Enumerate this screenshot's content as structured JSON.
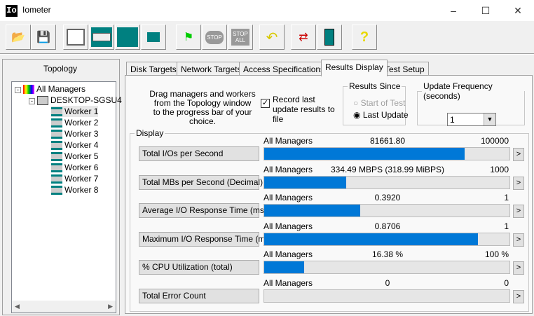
{
  "window": {
    "title": "Iometer",
    "icon_text": "Io"
  },
  "toolbar": {
    "buttons": [
      "open-icon",
      "save-icon",
      "start-manager-icon",
      "new-worker-icon",
      "new-network-worker-icon",
      "duplicate-worker-icon",
      "start-icon",
      "stop-icon",
      "stop-all-icon",
      "reset-icon",
      "disconnect-icon",
      "exit-icon",
      "help-icon"
    ],
    "stop_label": "STOP",
    "stop_all_label": "ALL",
    "help_label": "?"
  },
  "topology": {
    "title": "Topology",
    "root": "All Managers",
    "manager": "DESKTOP-SGSU4",
    "workers": [
      "Worker 1",
      "Worker 2",
      "Worker 3",
      "Worker 4",
      "Worker 5",
      "Worker 6",
      "Worker 7",
      "Worker 8"
    ]
  },
  "tabs": [
    "Disk Targets",
    "Network Targets",
    "Access Specifications",
    "Results Display",
    "Test Setup"
  ],
  "active_tab": "Results Display",
  "results": {
    "instructions": [
      "Drag managers and workers",
      "from the Topology window",
      "to the progress bar of your choice."
    ],
    "record_label": "Record last update results to file",
    "record_checked": true,
    "results_since": {
      "title": "Results Since",
      "options": [
        "Start of Test",
        "Last Update"
      ],
      "selected": "Last Update"
    },
    "update_frequency": {
      "title": "Update Frequency (seconds)",
      "value": "1"
    },
    "display_title": "Display",
    "rows": [
      {
        "button": "Total I/Os per Second",
        "source": "All Managers",
        "value": "81661.80",
        "max": "100000",
        "fill": 0.8166
      },
      {
        "button": "Total MBs per Second (Decimal)",
        "source": "All Managers",
        "value": "334.49 MBPS (318.99 MiBPS)",
        "max": "1000",
        "fill": 0.3345
      },
      {
        "button": "Average I/O Response Time (ms)",
        "source": "All Managers",
        "value": "0.3920",
        "max": "1",
        "fill": 0.392
      },
      {
        "button": "Maximum I/O Response Time (ms)",
        "source": "All Managers",
        "value": "0.8706",
        "max": "1",
        "fill": 0.8706
      },
      {
        "button": "% CPU Utilization (total)",
        "source": "All Managers",
        "value": "16.38 %",
        "max": "100 %",
        "fill": 0.1638
      },
      {
        "button": "Total Error Count",
        "source": "All Managers",
        "value": "0",
        "max": "0",
        "fill": 0
      }
    ],
    "arrow_label": ">"
  },
  "colors": {
    "bar": "#0078d7"
  }
}
